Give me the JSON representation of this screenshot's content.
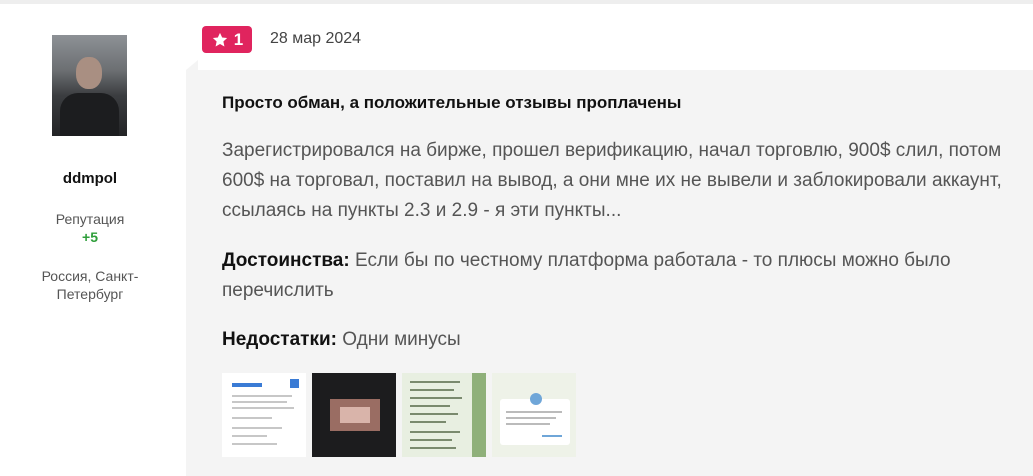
{
  "user": {
    "name": "ddmpol",
    "reputation_label": "Репутация",
    "reputation_value": "+5",
    "location": "Россия, Санкт-Петербург"
  },
  "review": {
    "rating": "1",
    "date": "28 мар 2024",
    "title": "Просто обман, а положительные отзывы проплачены",
    "text": "Зарегистрировался на бирже, прошел верификацию, начал торговлю, 900$ слил, потом 600$ на торговал, поставил на вывод, а они мне их не вывели и заблокировали аккаунт, ссылаясь на пункты 2.3 и 2.9 - я эти пункты...",
    "pros_label": "Достоинства:",
    "pros_text": "Если бы по честному платформа работала - то плюсы можно было перечислить",
    "cons_label": "Недостатки:",
    "cons_text": "Одни минусы"
  },
  "colors": {
    "badge": "#e0245e",
    "card_bg": "#f4f4f4",
    "reputation": "#2e9e3a"
  }
}
